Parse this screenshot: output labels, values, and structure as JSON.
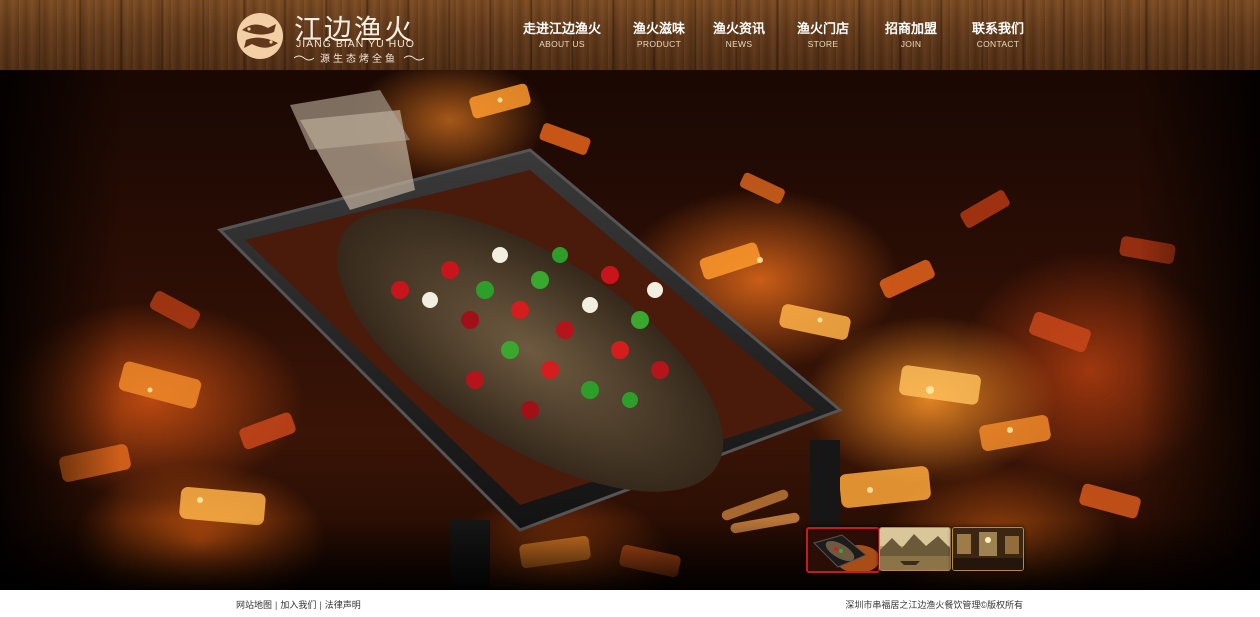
{
  "brand": {
    "name_cn": "江边渔火",
    "name_en": "JIANG BIAN YU HUO",
    "slogan": "源生态烤全鱼",
    "logo_icon": "twin-fish-icon"
  },
  "nav": [
    {
      "cn": "走进江边渔火",
      "en": "ABOUT US"
    },
    {
      "cn": "渔火滋味",
      "en": "PRODUCT"
    },
    {
      "cn": "渔火资讯",
      "en": "NEWS"
    },
    {
      "cn": "渔火门店",
      "en": "STORE"
    },
    {
      "cn": "招商加盟",
      "en": "JOIN"
    },
    {
      "cn": "联系我们",
      "en": "CONTACT"
    }
  ],
  "slider": {
    "slide_count": 3,
    "active_index": 0
  },
  "footer": {
    "links": [
      "网站地图",
      "加入我们",
      "法律声明"
    ],
    "separator": "|",
    "copyright": "深圳市串福居之江边渔火餐饮管理©版权所有"
  },
  "colors": {
    "header_wood": "#62391a",
    "active_thumb_border": "#c41b1b",
    "logo_mark": "#f3cfa6"
  }
}
